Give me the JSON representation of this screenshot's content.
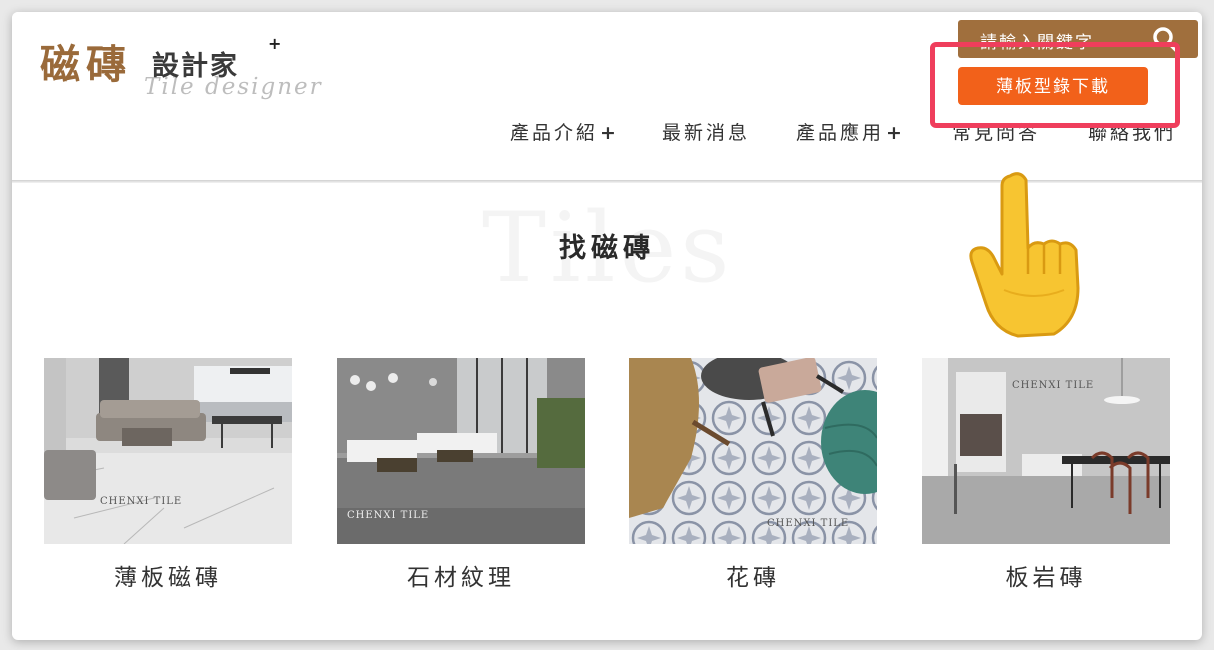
{
  "logo": {
    "main": "磁磚",
    "sub": "設計家",
    "plus": "+",
    "script": "Tile designer"
  },
  "search": {
    "placeholder": "請輸入關鍵字"
  },
  "download_button": "薄板型錄下載",
  "nav": [
    {
      "label": "產品介紹",
      "plus": "+"
    },
    {
      "label": "最新消息"
    },
    {
      "label": "產品應用",
      "plus": "+"
    },
    {
      "label": "常見問答"
    },
    {
      "label": "聯絡我們"
    }
  ],
  "watermark": "Tiles",
  "section_title": "找磁磚",
  "categories": [
    {
      "label": "薄板磁磚",
      "brand": "CHENXI TILE"
    },
    {
      "label": "石材紋理",
      "brand": "CHENXI TILE"
    },
    {
      "label": "花磚",
      "brand": "CHENXI TILE"
    },
    {
      "label": "板岩磚",
      "brand": "CHENXI TILE"
    }
  ],
  "colors": {
    "brand_brown": "#a06f3d",
    "download_orange": "#f2611a",
    "highlight_pink": "#ef3e5c"
  },
  "icons": [
    "search-icon",
    "pointing-hand-icon"
  ]
}
